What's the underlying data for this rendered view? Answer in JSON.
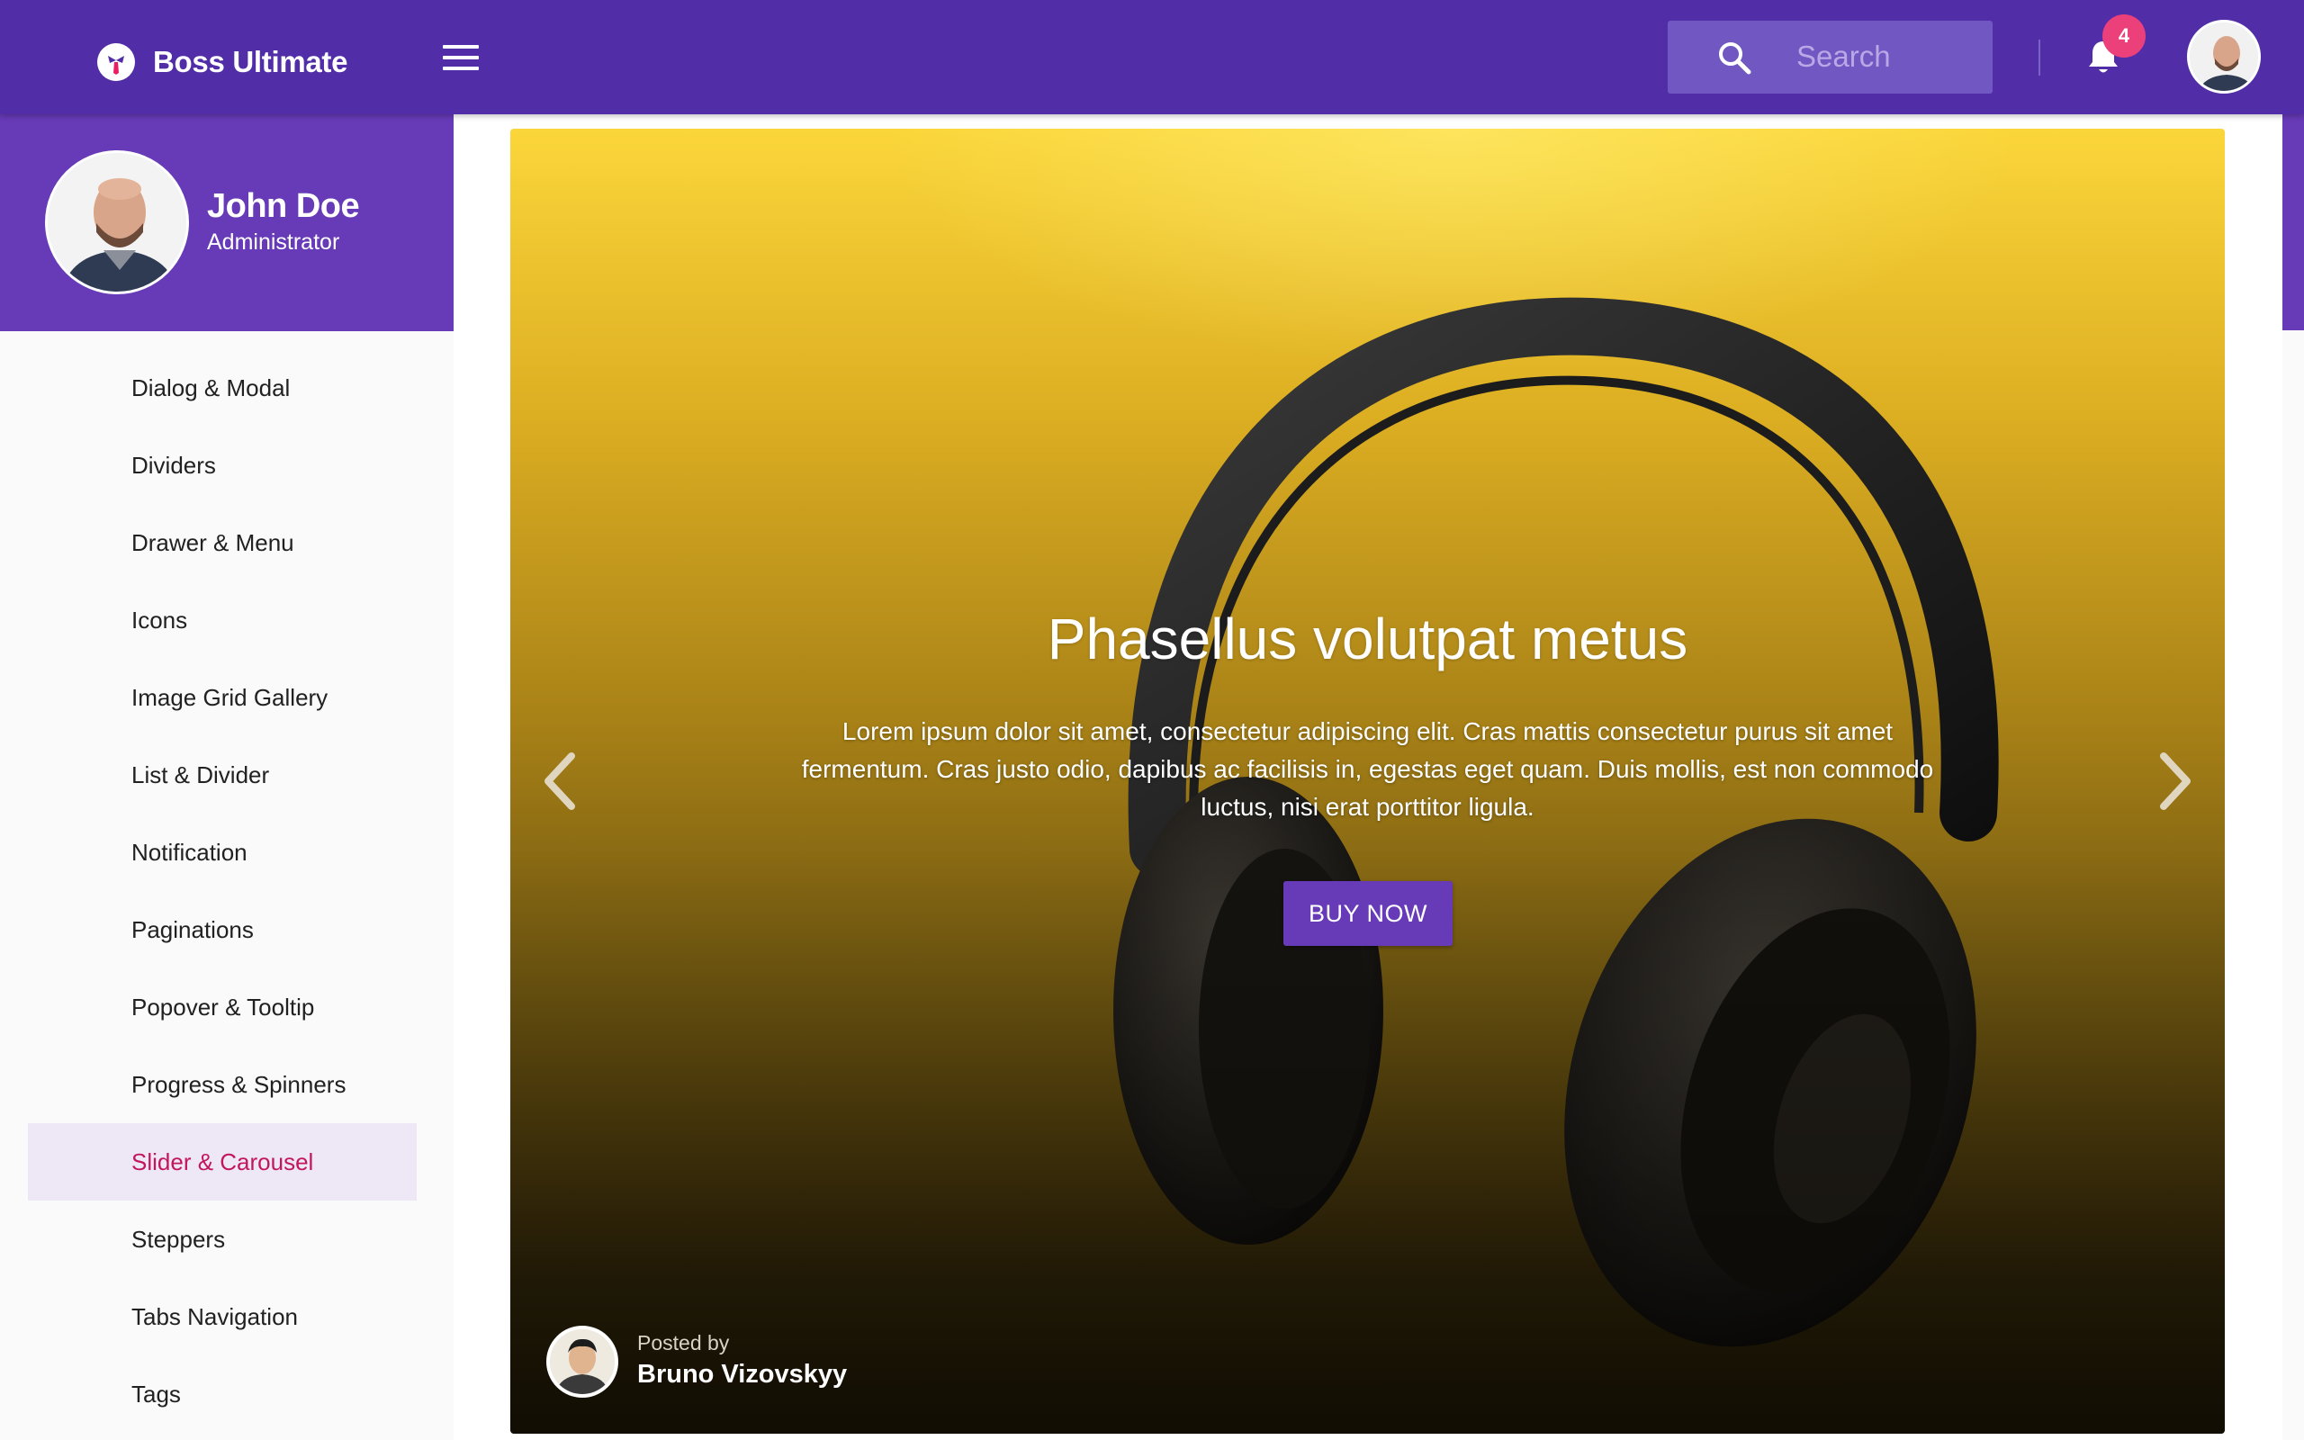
{
  "app": {
    "brand_name": "Boss Ultimate",
    "accent_color": "#512da8",
    "sidebar_header_color": "#673ab7"
  },
  "header": {
    "search": {
      "placeholder": "Search",
      "value": ""
    },
    "notifications": {
      "count": "4",
      "badge_color": "#ec407a"
    }
  },
  "profile": {
    "name": "John Doe",
    "role": "Administrator"
  },
  "sidebar": {
    "items": [
      {
        "label": "Dialog & Modal"
      },
      {
        "label": "Dividers"
      },
      {
        "label": "Drawer & Menu"
      },
      {
        "label": "Icons"
      },
      {
        "label": "Image Grid Gallery"
      },
      {
        "label": "List & Divider"
      },
      {
        "label": "Notification"
      },
      {
        "label": "Paginations"
      },
      {
        "label": "Popover & Tooltip"
      },
      {
        "label": "Progress & Spinners"
      },
      {
        "label": "Slider & Carousel",
        "active": true
      },
      {
        "label": "Steppers"
      },
      {
        "label": "Tabs Navigation"
      },
      {
        "label": "Tags"
      }
    ],
    "active_color": "#c2185b"
  },
  "carousel": {
    "title": "Phasellus volutpat metus",
    "text": "Lorem ipsum dolor sit amet, consectetur adipiscing elit. Cras mattis consectetur purus sit amet fermentum. Cras justo odio, dapibus ac facilisis in, egestas eget quam. Duis mollis, est non commodo luctus, nisi erat porttitor ligula.",
    "button_label": "BUY NOW",
    "posted_by_label": "Posted by",
    "author": "Bruno Vizovskyy"
  }
}
